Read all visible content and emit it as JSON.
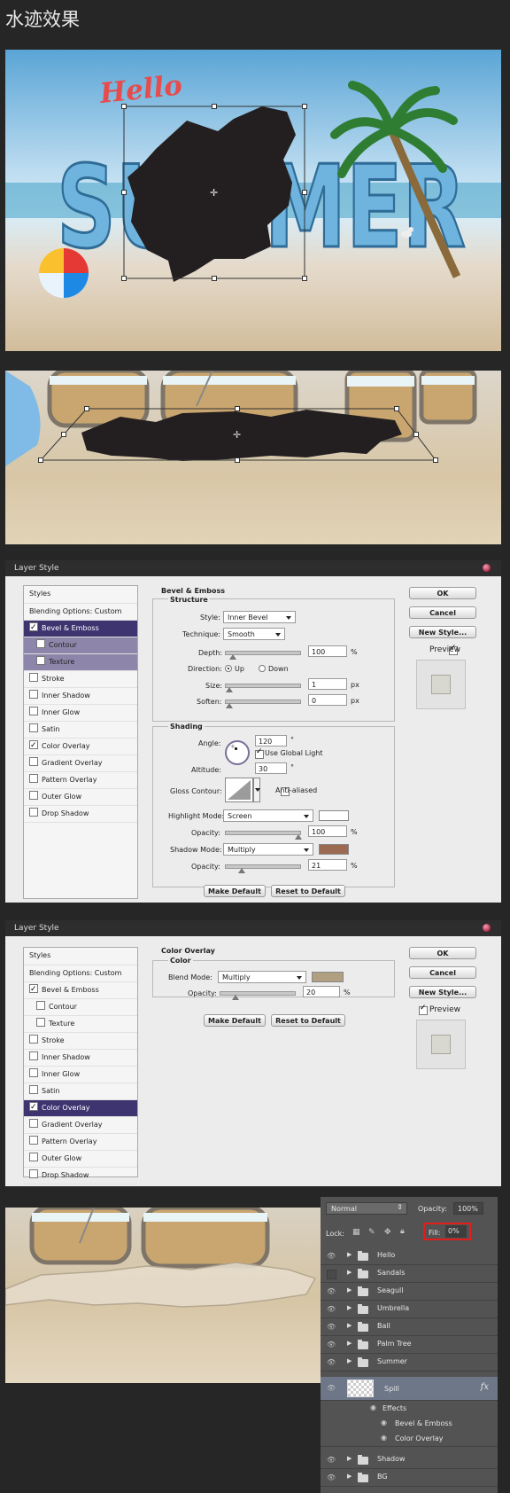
{
  "page": {
    "title": "水迹效果"
  },
  "scene1": {
    "hello_text": "Hello",
    "summer_text": "SUMMER"
  },
  "dialog1": {
    "title": "Layer Style",
    "styles_header": "Styles",
    "styles": [
      {
        "label": "Blending Options: Custom",
        "checkbox": false,
        "checked": false,
        "selected": false,
        "indent": false,
        "sub": false
      },
      {
        "label": "Bevel & Emboss",
        "checkbox": true,
        "checked": true,
        "selected": true,
        "indent": false,
        "sub": false
      },
      {
        "label": "Contour",
        "checkbox": true,
        "checked": false,
        "selected": false,
        "indent": true,
        "sub": true
      },
      {
        "label": "Texture",
        "checkbox": true,
        "checked": false,
        "selected": false,
        "indent": true,
        "sub": true
      },
      {
        "label": "Stroke",
        "checkbox": true,
        "checked": false,
        "selected": false,
        "indent": false,
        "sub": false
      },
      {
        "label": "Inner Shadow",
        "checkbox": true,
        "checked": false,
        "selected": false,
        "indent": false,
        "sub": false
      },
      {
        "label": "Inner Glow",
        "checkbox": true,
        "checked": false,
        "selected": false,
        "indent": false,
        "sub": false
      },
      {
        "label": "Satin",
        "checkbox": true,
        "checked": false,
        "selected": false,
        "indent": false,
        "sub": false
      },
      {
        "label": "Color Overlay",
        "checkbox": true,
        "checked": true,
        "selected": false,
        "indent": false,
        "sub": false
      },
      {
        "label": "Gradient Overlay",
        "checkbox": true,
        "checked": false,
        "selected": false,
        "indent": false,
        "sub": false
      },
      {
        "label": "Pattern Overlay",
        "checkbox": true,
        "checked": false,
        "selected": false,
        "indent": false,
        "sub": false
      },
      {
        "label": "Outer Glow",
        "checkbox": true,
        "checked": false,
        "selected": false,
        "indent": false,
        "sub": false
      },
      {
        "label": "Drop Shadow",
        "checkbox": true,
        "checked": false,
        "selected": false,
        "indent": false,
        "sub": false
      }
    ],
    "section_title": "Bevel & Emboss",
    "structure_title": "Structure",
    "style_label": "Style:",
    "style_value": "Inner Bevel",
    "technique_label": "Technique:",
    "technique_value": "Smooth",
    "depth_label": "Depth:",
    "depth_value": "100",
    "depth_unit": "%",
    "direction_label": "Direction:",
    "dir_up": "Up",
    "dir_down": "Down",
    "size_label": "Size:",
    "size_value": "1",
    "size_unit": "px",
    "soften_label": "Soften:",
    "soften_value": "0",
    "soften_unit": "px",
    "shading_title": "Shading",
    "angle_label": "Angle:",
    "angle_value": "120",
    "angle_unit": "°",
    "global_light_label": "Use Global Light",
    "altitude_label": "Altitude:",
    "altitude_value": "30",
    "altitude_unit": "°",
    "gloss_label": "Gloss Contour:",
    "anti_aliased_label": "Anti-aliased",
    "highlight_mode_label": "Highlight Mode:",
    "highlight_mode_value": "Screen",
    "highlight_color": "#ffffff",
    "highlight_opacity_label": "Opacity:",
    "highlight_opacity_value": "100",
    "highlight_opacity_unit": "%",
    "shadow_mode_label": "Shadow Mode:",
    "shadow_mode_value": "Multiply",
    "shadow_color": "#9c6a51",
    "shadow_opacity_label": "Opacity:",
    "shadow_opacity_value": "21",
    "shadow_opacity_unit": "%",
    "make_default": "Make Default",
    "reset_default": "Reset to Default",
    "ok": "OK",
    "cancel": "Cancel",
    "new_style": "New Style...",
    "preview": "Preview"
  },
  "dialog2": {
    "title": "Layer Style",
    "styles_header": "Styles",
    "styles": [
      {
        "label": "Blending Options: Custom",
        "checkbox": false,
        "checked": false,
        "selected": false,
        "indent": false,
        "sub": false
      },
      {
        "label": "Bevel & Emboss",
        "checkbox": true,
        "checked": true,
        "selected": false,
        "indent": false,
        "sub": false
      },
      {
        "label": "Contour",
        "checkbox": true,
        "checked": false,
        "selected": false,
        "indent": true,
        "sub": false
      },
      {
        "label": "Texture",
        "checkbox": true,
        "checked": false,
        "selected": false,
        "indent": true,
        "sub": false
      },
      {
        "label": "Stroke",
        "checkbox": true,
        "checked": false,
        "selected": false,
        "indent": false,
        "sub": false
      },
      {
        "label": "Inner Shadow",
        "checkbox": true,
        "checked": false,
        "selected": false,
        "indent": false,
        "sub": false
      },
      {
        "label": "Inner Glow",
        "checkbox": true,
        "checked": false,
        "selected": false,
        "indent": false,
        "sub": false
      },
      {
        "label": "Satin",
        "checkbox": true,
        "checked": false,
        "selected": false,
        "indent": false,
        "sub": false
      },
      {
        "label": "Color Overlay",
        "checkbox": true,
        "checked": true,
        "selected": true,
        "indent": false,
        "sub": false
      },
      {
        "label": "Gradient Overlay",
        "checkbox": true,
        "checked": false,
        "selected": false,
        "indent": false,
        "sub": false
      },
      {
        "label": "Pattern Overlay",
        "checkbox": true,
        "checked": false,
        "selected": false,
        "indent": false,
        "sub": false
      },
      {
        "label": "Outer Glow",
        "checkbox": true,
        "checked": false,
        "selected": false,
        "indent": false,
        "sub": false
      },
      {
        "label": "Drop Shadow",
        "checkbox": true,
        "checked": false,
        "selected": false,
        "indent": false,
        "sub": false
      }
    ],
    "section_title": "Color Overlay",
    "color_title": "Color",
    "blend_mode_label": "Blend Mode:",
    "blend_mode_value": "Multiply",
    "overlay_color": "#b09f80",
    "opacity_label": "Opacity:",
    "opacity_value": "20",
    "opacity_unit": "%",
    "make_default": "Make Default",
    "reset_default": "Reset to Default",
    "ok": "OK",
    "cancel": "Cancel",
    "new_style": "New Style...",
    "preview": "Preview"
  },
  "layers": {
    "blend_mode": "Normal",
    "opacity_label": "Opacity:",
    "opacity_value": "100%",
    "lock_label": "Lock:",
    "fill_label": "Fill:",
    "fill_value": "0%",
    "groups_top": [
      {
        "name": "Hello",
        "visible": true
      },
      {
        "name": "Sandals",
        "visible": false
      },
      {
        "name": "Seagull",
        "visible": true
      },
      {
        "name": "Umbrella",
        "visible": true
      },
      {
        "name": "Ball",
        "visible": true
      },
      {
        "name": "Palm Tree",
        "visible": true
      },
      {
        "name": "Summer",
        "visible": true
      }
    ],
    "spill": {
      "name": "Spill",
      "fx": "fx",
      "effects_label": "Effects",
      "effects": [
        "Bevel & Emboss",
        "Color Overlay"
      ]
    },
    "groups_bottom": [
      {
        "name": "Shadow",
        "visible": true
      },
      {
        "name": "BG",
        "visible": true
      }
    ]
  }
}
